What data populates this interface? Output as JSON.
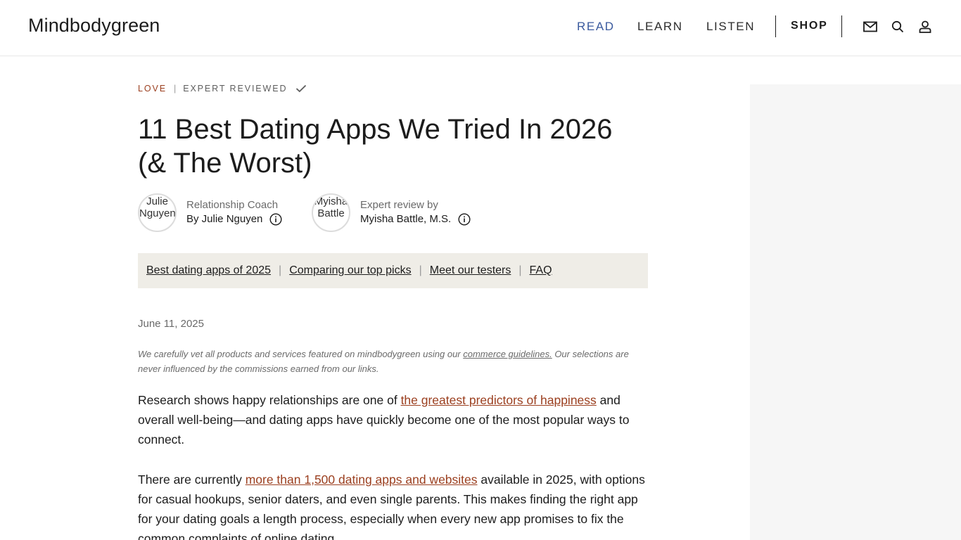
{
  "header": {
    "logo": "Mindbodygreen",
    "nav": {
      "read": "READ",
      "learn": "LEARN",
      "listen": "LISTEN",
      "shop": "SHOP"
    },
    "icons": [
      "mail-icon",
      "search-icon",
      "user-icon"
    ],
    "accent_color": "#3a5a9e"
  },
  "article": {
    "category": "LOVE",
    "separator": "|",
    "reviewed_label": "EXPERT REVIEWED",
    "title_line1": "11 Best Dating Apps We Tried In 2026",
    "title_line2": "(& The Worst)",
    "author": {
      "avatar_alt": "Julie Nguyen",
      "role": "Relationship Coach",
      "byline": "By Julie Nguyen"
    },
    "reviewer": {
      "avatar_alt": "Myisha Battle",
      "role": "Expert review by",
      "name": "Myisha Battle, M.S."
    },
    "toc": [
      "Best dating apps of 2025",
      "Comparing our top picks",
      "Meet our testers",
      "FAQ"
    ],
    "date": "June 11, 2025",
    "disclaimer": {
      "before": "We carefully vet all products and services featured on mindbodygreen using our ",
      "link": "commerce guidelines.",
      "after": " Our selections are never influenced by the commissions earned from our links."
    },
    "para1": {
      "before": "Research shows happy relationships are one of ",
      "link": "the greatest predictors of happiness",
      "after": " and overall well-being—and dating apps have quickly become one of the most popular ways to connect."
    },
    "para2": {
      "before": "There are currently ",
      "link": "more than 1,500 dating apps and websites",
      "after": " available in 2025, with options for casual hookups, senior daters, and even single parents. This makes finding the right app for your dating goals a length process, especially when every new app promises to fix the common complaints of online dating."
    },
    "category_color": "#9b3f1f"
  }
}
